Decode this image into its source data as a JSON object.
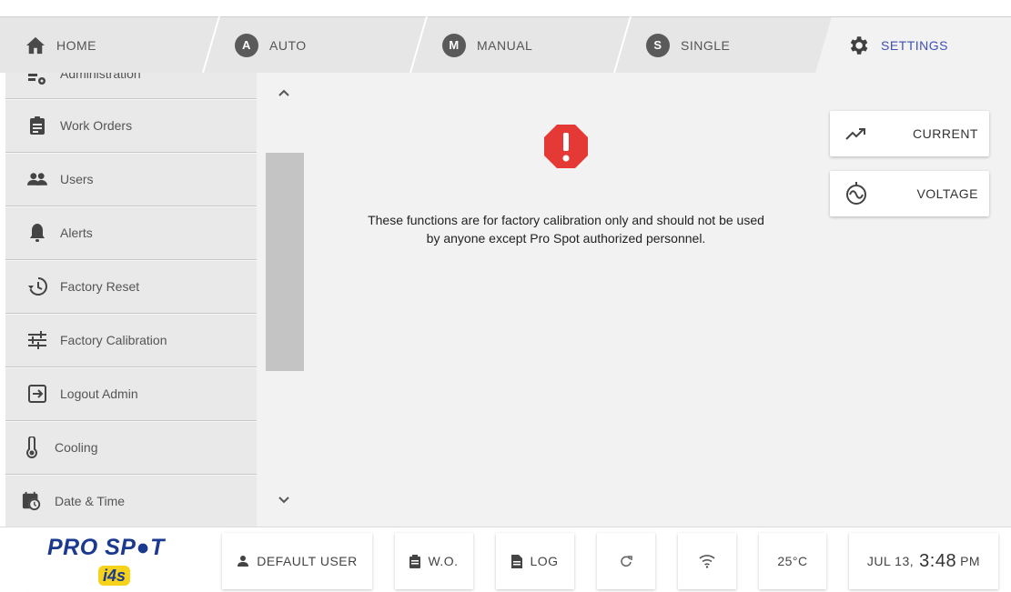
{
  "tabs": {
    "home": {
      "label": "HOME"
    },
    "auto": {
      "label": "AUTO",
      "badge": "A"
    },
    "manual": {
      "label": "MANUAL",
      "badge": "M"
    },
    "single": {
      "label": "SINGLE",
      "badge": "S"
    },
    "settings": {
      "label": "SETTINGS"
    }
  },
  "sidebar": {
    "items": [
      {
        "label": "Administration",
        "icon": "admin-settings-icon"
      },
      {
        "label": "Work Orders",
        "icon": "clipboard-icon"
      },
      {
        "label": "Users",
        "icon": "users-icon"
      },
      {
        "label": "Alerts",
        "icon": "bell-icon"
      },
      {
        "label": "Factory Reset",
        "icon": "history-icon"
      },
      {
        "label": "Factory Calibration",
        "icon": "tune-sliders-icon"
      },
      {
        "label": "Logout Admin",
        "icon": "exit-icon"
      },
      {
        "label": "Cooling",
        "icon": "thermometer-icon"
      },
      {
        "label": "Date & Time",
        "icon": "calendar-clock-icon"
      }
    ]
  },
  "content": {
    "warning_text_line1": "These functions are for factory calibration only and should not be used",
    "warning_text_line2": "by anyone except Pro Spot authorized personnel.",
    "buttons": {
      "current": "CURRENT",
      "voltage": "VOLTAGE"
    }
  },
  "statusbar": {
    "logo": "PRO SP●T",
    "logo_sub": "i4s",
    "user": "DEFAULT USER",
    "wo": "W.O.",
    "log": "LOG",
    "temperature": "25°C",
    "date": "JUL 13,",
    "time": "3:48",
    "ampm": "PM"
  },
  "colors": {
    "accent": "#3f51b5",
    "warning": "#e53935",
    "brand_blue": "#1b3a8f",
    "brand_yellow": "#f6d21a"
  }
}
